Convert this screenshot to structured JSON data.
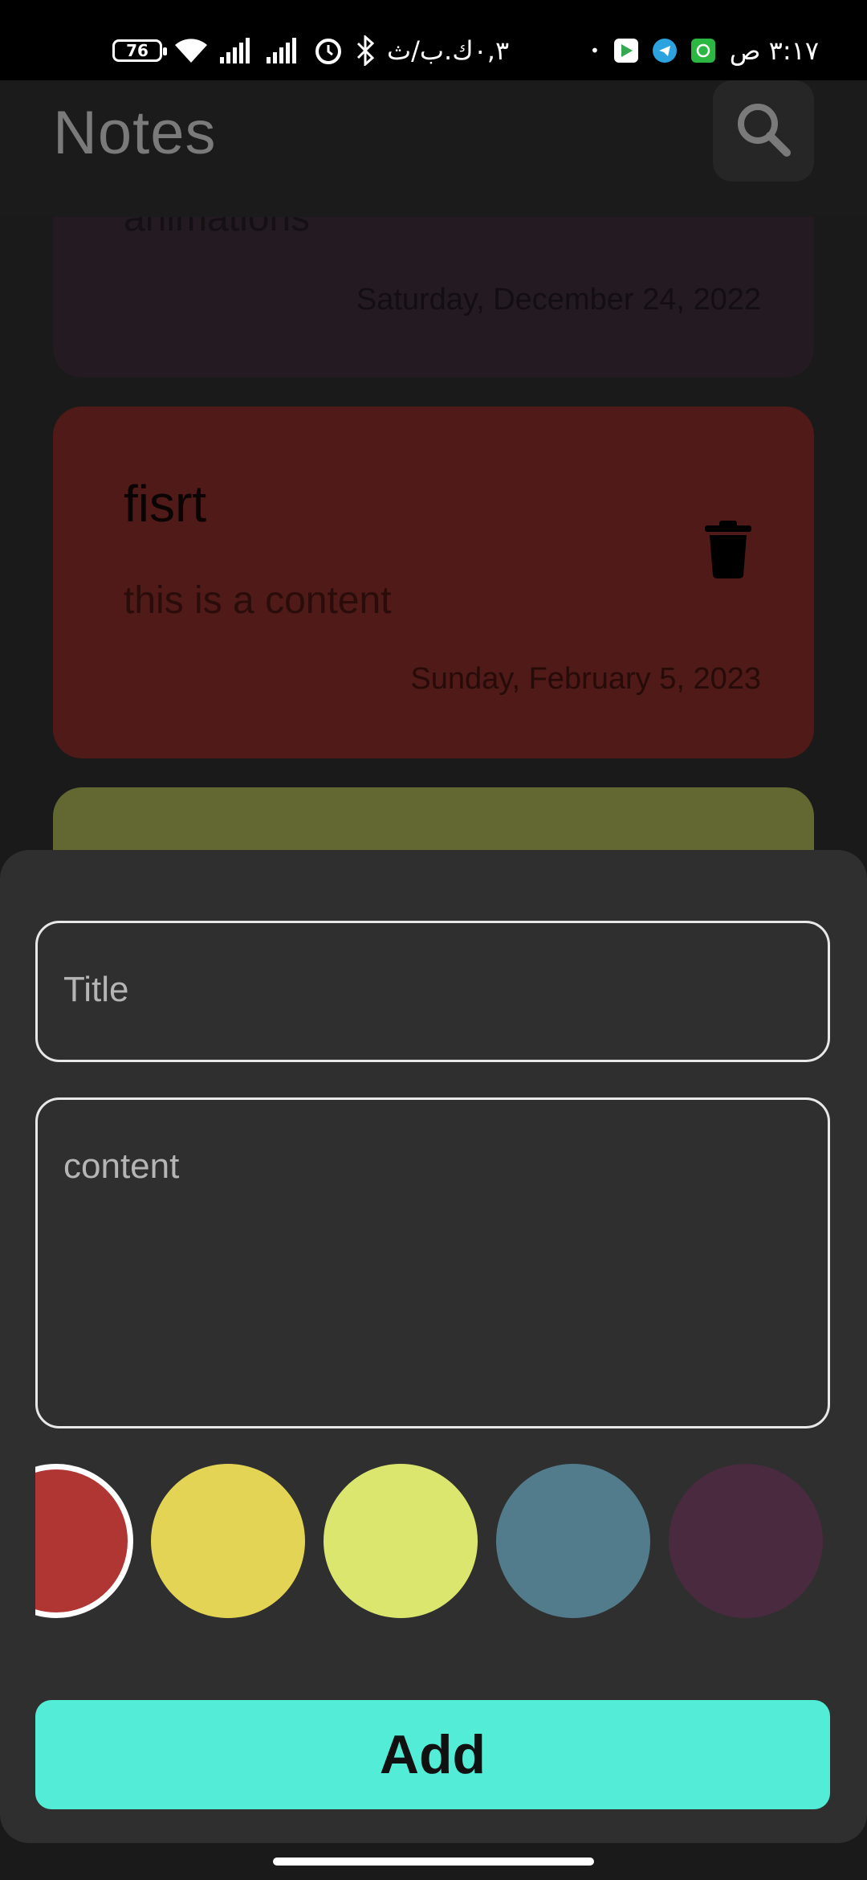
{
  "status_bar": {
    "time": "٣:١٧ ص",
    "battery": "76",
    "network_speed": "٠,٣ك.ب/ث",
    "dot": "•"
  },
  "header": {
    "title": "Notes",
    "search_icon": "search-icon"
  },
  "notes": [
    {
      "title": "",
      "content": "animations",
      "date": "Saturday, December 24, 2022",
      "color": "#231b21"
    },
    {
      "title": "fisrt",
      "content": "this is a content",
      "date": "Sunday, February 5, 2023",
      "color": "#4f1a17",
      "delete_icon": "trash-icon"
    },
    {
      "title": "",
      "content": "",
      "date": "",
      "color": "#636732"
    }
  ],
  "sheet": {
    "title_placeholder": "Title",
    "content_placeholder": "content",
    "colors": [
      "#b03634",
      "#e4d455",
      "#dbe66f",
      "#527c8c",
      "#4a2a3e"
    ],
    "selected_color_index": 0,
    "add_label": "Add"
  }
}
